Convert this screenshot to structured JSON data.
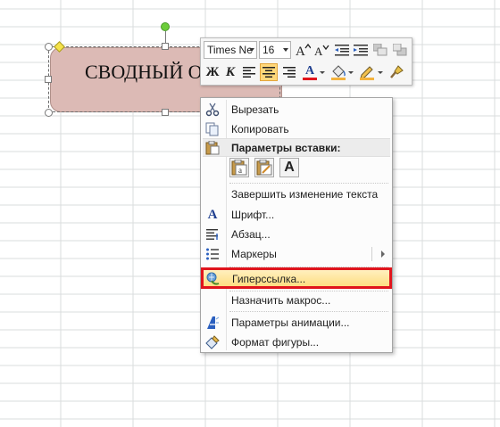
{
  "shape": {
    "text": "СВОДНЫЙ О"
  },
  "mini_toolbar": {
    "font_name": "Times Ne",
    "font_size": "16",
    "bold_label": "Ж",
    "italic_label": "К",
    "font_color_label": "А",
    "font_color": "#e0141c"
  },
  "context_menu": {
    "items": [
      {
        "label": "Вырезать",
        "icon": "scissors-icon"
      },
      {
        "label": "Копировать",
        "icon": "copy-icon"
      },
      {
        "label": "Параметры вставки:",
        "icon": "clipboard-icon"
      },
      {
        "label": "Завершить изменение текста",
        "icon": ""
      },
      {
        "label": "Шрифт...",
        "icon": "font-icon"
      },
      {
        "label": "Абзац...",
        "icon": "paragraph-icon"
      },
      {
        "label": "Маркеры",
        "icon": "bullets-icon"
      },
      {
        "label": "Гиперссылка...",
        "icon": "hyperlink-icon"
      },
      {
        "label": "Назначить макрос...",
        "icon": ""
      },
      {
        "label": "Параметры анимации...",
        "icon": "animation-icon"
      },
      {
        "label": "Формат фигуры...",
        "icon": "format-shape-icon"
      }
    ],
    "paste_option_letter": "A"
  },
  "colors": {
    "shape_fill": "#dcbab5",
    "highlight": "#e0141c",
    "menu_hover": "#fedc7e"
  }
}
